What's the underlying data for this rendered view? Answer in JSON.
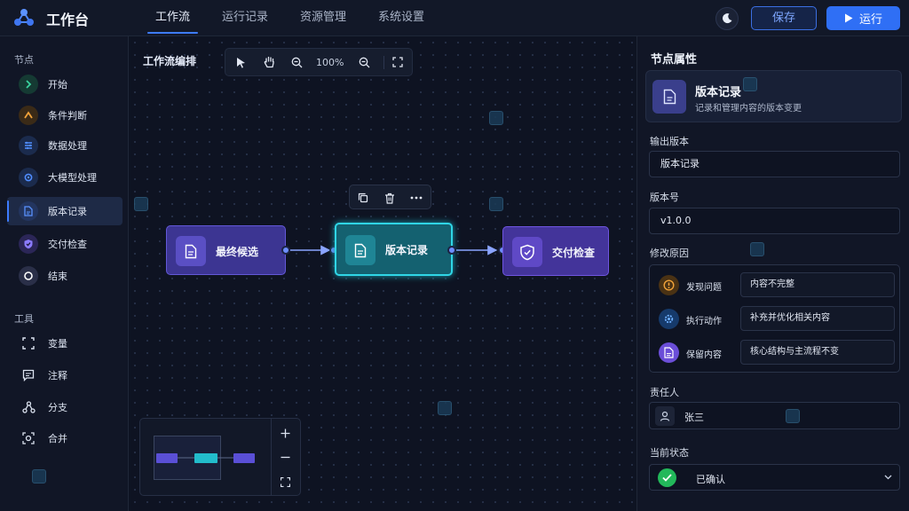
{
  "app": {
    "title": "工作台",
    "logo_icon": "workflow-logo-icon"
  },
  "nav": {
    "tabs": [
      {
        "label": "工作流",
        "active": true
      },
      {
        "label": "运行记录",
        "active": false
      },
      {
        "label": "资源管理",
        "active": false
      },
      {
        "label": "系统设置",
        "active": false
      }
    ]
  },
  "header": {
    "theme_icon": "moon-icon",
    "save_label": "保存",
    "run_label": "运行",
    "run_icon": "play-icon"
  },
  "sidebar": {
    "nodes_title": "节点",
    "nodes": [
      {
        "label": "开始",
        "icon": "chevron-right-icon",
        "color": "#3ad29f"
      },
      {
        "label": "条件判断",
        "icon": "branch-icon",
        "color": "#f0a23a"
      },
      {
        "label": "数据处理",
        "icon": "sliders-icon",
        "color": "#4f8cff"
      },
      {
        "label": "大模型处理",
        "icon": "gear-icon",
        "color": "#4f8cff"
      },
      {
        "label": "版本记录",
        "icon": "document-icon",
        "color": "#4f8cff",
        "active": true
      },
      {
        "label": "交付检查",
        "icon": "shield-check-icon",
        "color": "#8b7bff"
      },
      {
        "label": "结束",
        "icon": "stop-icon",
        "color": "#ffffff"
      }
    ],
    "tools_title": "工具",
    "tools": [
      {
        "label": "变量",
        "icon": "brackets-icon"
      },
      {
        "label": "注释",
        "icon": "comment-icon"
      },
      {
        "label": "分支",
        "icon": "fork-icon"
      },
      {
        "label": "合并",
        "icon": "merge-icon"
      }
    ]
  },
  "canvas": {
    "title": "工作流编排",
    "zoom": "100%",
    "nodes": [
      {
        "label": "最终候选",
        "icon": "document-icon"
      },
      {
        "label": "版本记录",
        "icon": "document-icon",
        "selected": true
      },
      {
        "label": "交付检查",
        "icon": "shield-check-icon"
      }
    ]
  },
  "panel": {
    "title": "节点属性",
    "summary": {
      "title": "版本记录",
      "description": "记录和管理内容的版本变更"
    },
    "output_version": {
      "label": "输出版本",
      "value": "版本记录"
    },
    "version_number": {
      "label": "版本号",
      "value": "v1.0.0"
    },
    "reason": {
      "label": "修改原因",
      "rows": [
        {
          "label": "发现问题",
          "value": "内容不完整",
          "icon": "alert-icon",
          "color": "#f0a23a"
        },
        {
          "label": "执行动作",
          "value": "补充并优化相关内容",
          "icon": "gear-icon",
          "color": "#3d8bff"
        },
        {
          "label": "保留内容",
          "value": "核心结构与主流程不变",
          "icon": "document-icon",
          "color": "#8b6cff"
        }
      ]
    },
    "owner": {
      "label": "责任人",
      "value": "张三"
    },
    "status": {
      "label": "当前状态",
      "value": "已确认"
    }
  }
}
